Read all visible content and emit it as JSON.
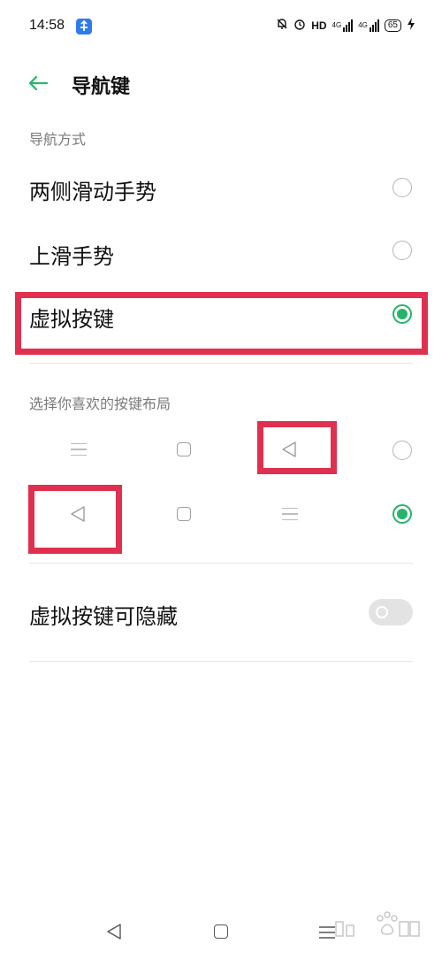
{
  "status_bar": {
    "time": "14:58",
    "network": "HD",
    "signal_1": "4G",
    "signal_2": "4G",
    "battery": "65",
    "icons": [
      "notification-app-icon",
      "do-not-disturb-icon",
      "alarm-icon",
      "charging-icon"
    ]
  },
  "header": {
    "back_icon": "arrow-left-icon",
    "title": "导航键"
  },
  "nav_mode": {
    "section_label": "导航方式",
    "options": [
      {
        "label": "两侧滑动手势",
        "selected": false
      },
      {
        "label": "上滑手势",
        "selected": false
      },
      {
        "label": "虚拟按键",
        "selected": true
      }
    ]
  },
  "layout": {
    "section_label": "选择你喜欢的按键布局",
    "rows": [
      {
        "keys": [
          "menu-icon",
          "home-square-icon",
          "back-triangle-icon"
        ],
        "selected": false
      },
      {
        "keys": [
          "back-triangle-icon",
          "home-square-icon",
          "menu-icon"
        ],
        "selected": true
      }
    ]
  },
  "hideable": {
    "label": "虚拟按键可隐藏",
    "enabled": false
  },
  "bottom_nav": [
    "back-triangle-icon",
    "home-square-icon",
    "menu-icon"
  ],
  "colors": {
    "accent": "#28b36a",
    "highlight": "#e0304f",
    "divider": "#e6e6e6"
  }
}
